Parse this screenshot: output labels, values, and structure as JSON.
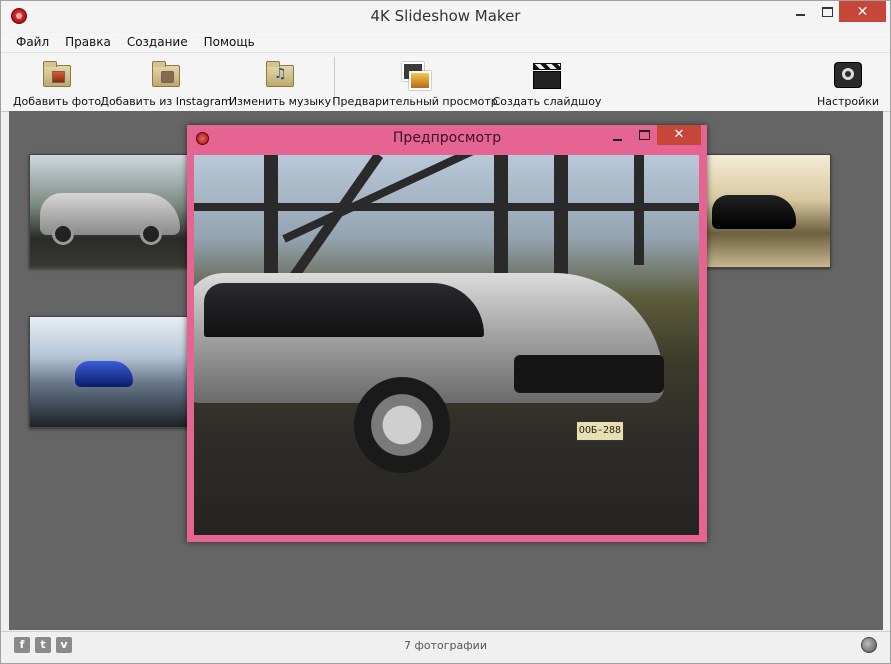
{
  "window": {
    "title": "4K Slideshow Maker",
    "minimize_glyph": "",
    "close_glyph": "✕"
  },
  "menu": [
    "Файл",
    "Правка",
    "Создание",
    "Помощь"
  ],
  "toolbar": {
    "add_photo": "Добавить фото",
    "add_instagram": "Добавить из Instagram",
    "change_music": "Изменить музыку",
    "preview": "Предварительный просмотр",
    "create_slideshow": "Создать слайдшоу",
    "settings": "Настройки"
  },
  "preview_dialog": {
    "title": "Предпросмотр",
    "close_glyph": "✕",
    "plate": "ООБ-288"
  },
  "status": {
    "photo_count": "7 фотографии",
    "social": {
      "facebook": "f",
      "twitter": "t",
      "vimeo": "v"
    }
  },
  "colors": {
    "dialog_frame": "#e56491",
    "close_button": "#c7463a",
    "workspace": "#656565"
  },
  "icons": [
    "app-logo-icon",
    "add-photo-icon",
    "instagram-icon",
    "music-icon",
    "preview-icon",
    "clapperboard-icon",
    "settings-gear-icon",
    "globe-icon"
  ]
}
